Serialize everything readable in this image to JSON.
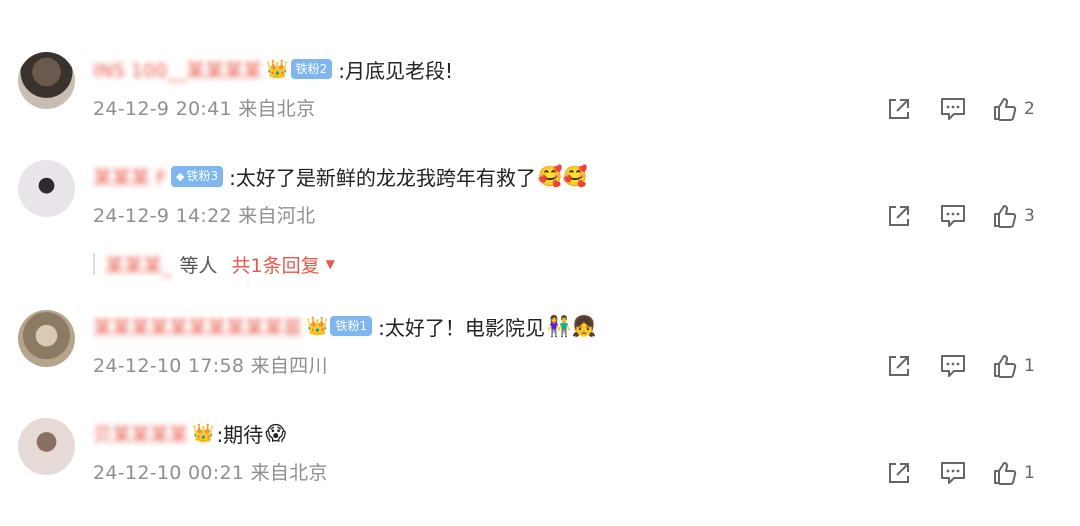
{
  "comments": [
    {
      "username": "INS 100__某某某某",
      "badge": "铁粉2",
      "badge_diamond": false,
      "text": ":月底见老段!",
      "emojis": "",
      "timestamp": "24-12-9 20:41 来自北京",
      "likes": "2"
    },
    {
      "username": "某某某 F",
      "badge": "铁粉3",
      "badge_diamond": true,
      "text": ":太好了是新鲜的龙龙我跨年有救了",
      "emojis": "🥰🥰",
      "timestamp": "24-12-9 14:22 来自河北",
      "likes": "3"
    },
    {
      "username": "某某某某某某某某某某苗",
      "badge": "铁粉1",
      "badge_diamond": false,
      "text": ":太好了！电影院见",
      "emojis": "👫👧",
      "timestamp": "24-12-10 17:58 来自四川",
      "likes": "1"
    },
    {
      "username": "贝某某某某",
      "badge": "",
      "badge_diamond": false,
      "text": ":期待",
      "emojis": "😱",
      "timestamp": "24-12-10 00:21 来自北京",
      "likes": "1"
    }
  ],
  "replies": {
    "names": "某某某_",
    "suffix": "等人",
    "link": "共1条回复"
  },
  "icons": {
    "share": "share-icon",
    "comment": "comment-icon",
    "like": "thumbs-up-icon",
    "crown": "crown-icon",
    "caret": "caret-down-icon"
  },
  "colors": {
    "username": "#e8594a",
    "badge": "#7eb6ef",
    "meta": "#8f8f8f",
    "reply_link": "#e8594a"
  }
}
